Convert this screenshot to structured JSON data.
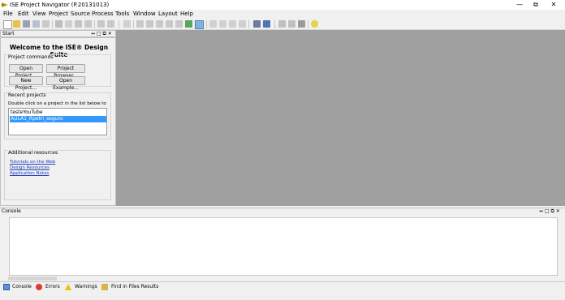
{
  "window": {
    "title": "ISE Project Navigator (P.20131013)",
    "minimize": "—",
    "restore": "⧉",
    "close": "✕"
  },
  "menu": [
    "File",
    "Edit",
    "View",
    "Project",
    "Source",
    "Process",
    "Tools",
    "Window",
    "Layout",
    "Help"
  ],
  "start_panel": {
    "title": "Start",
    "controls": "↔ □ ⧉ ✕",
    "welcome": "Welcome to the ISE® Design Suite",
    "project_commands": {
      "title": "Project commands",
      "open_project": "Open Project...",
      "project_browser": "Project Browser...",
      "new_project": "New Project...",
      "open_example": "Open Example..."
    },
    "recent": {
      "title": "Recent projects",
      "hint": "Double click on a project in the list below to open",
      "items": [
        "testeYouTube",
        "AULA1_Rpetri_seguro"
      ]
    },
    "additional": {
      "title": "Additional resources",
      "links": [
        "Tutorials on the Web",
        "Design Resources",
        "Application Notes"
      ]
    }
  },
  "console": {
    "title": "Console",
    "controls": "↔ □ ⧉ ✕"
  },
  "bottom_tabs": [
    "Console",
    "Errors",
    "Warnings",
    "Find in Files Results"
  ],
  "colors": {
    "selection": "#3399ff",
    "workspace": "#a0a0a0",
    "link": "#1f3fbf"
  }
}
